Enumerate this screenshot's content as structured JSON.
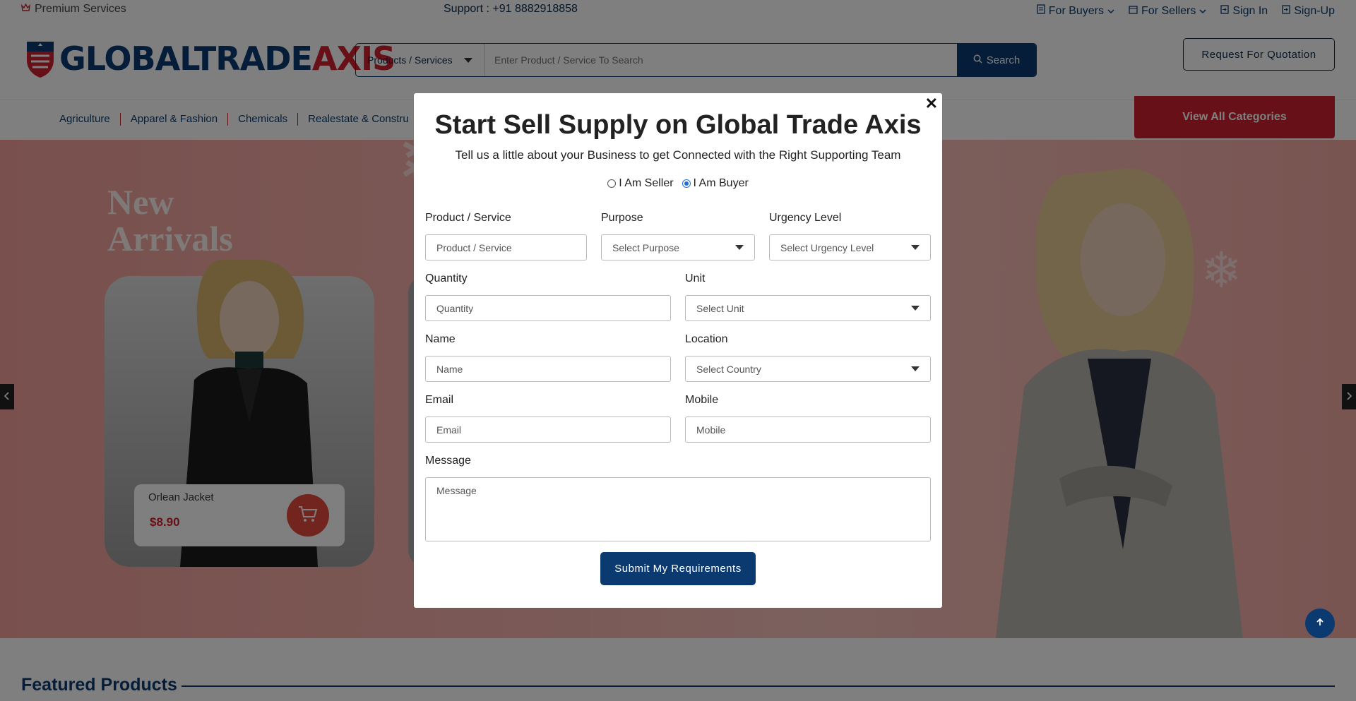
{
  "topbar": {
    "premium": "Premium Services",
    "support": "Support : +91 8882918858",
    "links": [
      {
        "label": "For Buyers",
        "icon": "document-icon",
        "dropdown": true
      },
      {
        "label": "For Sellers",
        "icon": "card-icon",
        "dropdown": true
      },
      {
        "label": "Sign In",
        "icon": "sign-in-icon",
        "dropdown": false
      },
      {
        "label": "Sign-Up",
        "icon": "sign-up-icon",
        "dropdown": false
      }
    ]
  },
  "header": {
    "logo_blue": "GLOBALTRADE",
    "logo_red": "AXIS",
    "search_category": "Products / Services",
    "search_placeholder": "Enter Product / Service To Search",
    "search_button": "Search",
    "rfq_button": "Request For Quotation"
  },
  "nav": {
    "items": [
      "Agriculture",
      "Apparel & Fashion",
      "Chemicals",
      "Realestate & Constru"
    ],
    "view_all": "View All Categories"
  },
  "banner": {
    "heading_line1": "New",
    "heading_line2": "Arrivals",
    "product_name": "Orlean Jacket",
    "product_price": "$8.90"
  },
  "featured": {
    "title": "Featured Products"
  },
  "modal": {
    "title": "Start Sell Supply on Global Trade Axis",
    "subtitle": "Tell us a little about your Business to get Connected with the Right Supporting Team",
    "radio_seller": "I Am Seller",
    "radio_buyer": "I Am Buyer",
    "selected_role": "buyer",
    "fields": {
      "product": {
        "label": "Product / Service",
        "placeholder": "Product / Service"
      },
      "purpose": {
        "label": "Purpose",
        "value": "Select Purpose"
      },
      "urgency": {
        "label": "Urgency Level",
        "value": "Select Urgency Level"
      },
      "quantity": {
        "label": "Quantity",
        "placeholder": "Quantity"
      },
      "unit": {
        "label": "Unit",
        "value": "Select Unit"
      },
      "name": {
        "label": "Name",
        "placeholder": "Name"
      },
      "location": {
        "label": "Location",
        "value": "Select Country"
      },
      "email": {
        "label": "Email",
        "placeholder": "Email"
      },
      "mobile": {
        "label": "Mobile",
        "placeholder": "Mobile"
      },
      "message": {
        "label": "Message",
        "placeholder": "Message"
      }
    },
    "submit": "Submit My Requirements"
  },
  "colors": {
    "brand_blue": "#0b3a70",
    "brand_red": "#d0202e"
  }
}
